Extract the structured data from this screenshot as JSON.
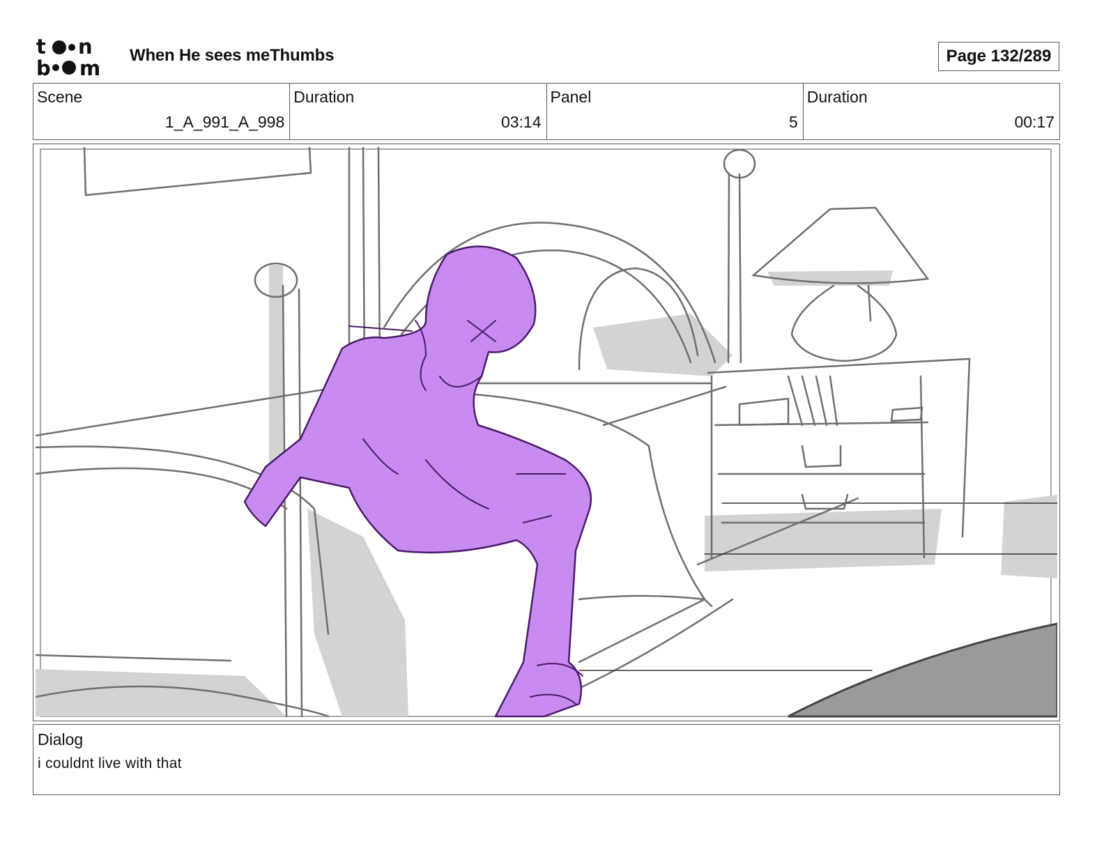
{
  "header": {
    "logo_text": "toon boom",
    "title": "When He sees meThumbs",
    "page_label": "Page 132/289"
  },
  "info": {
    "scene_label": "Scene",
    "scene_value": "1_A_991_A_998",
    "scene_duration_label": "Duration",
    "scene_duration_value": "03:14",
    "panel_label": "Panel",
    "panel_value": "5",
    "panel_duration_label": "Duration",
    "panel_duration_value": "00:17"
  },
  "dialog": {
    "label": "Dialog",
    "text": "i couldnt live with that"
  },
  "colors": {
    "character_fill": "#c88cf0",
    "character_line": "#4a1a6a",
    "sketch_line": "#6e6e6e",
    "shadow": "#d3d3d3",
    "rug": "#9a9a9a"
  }
}
